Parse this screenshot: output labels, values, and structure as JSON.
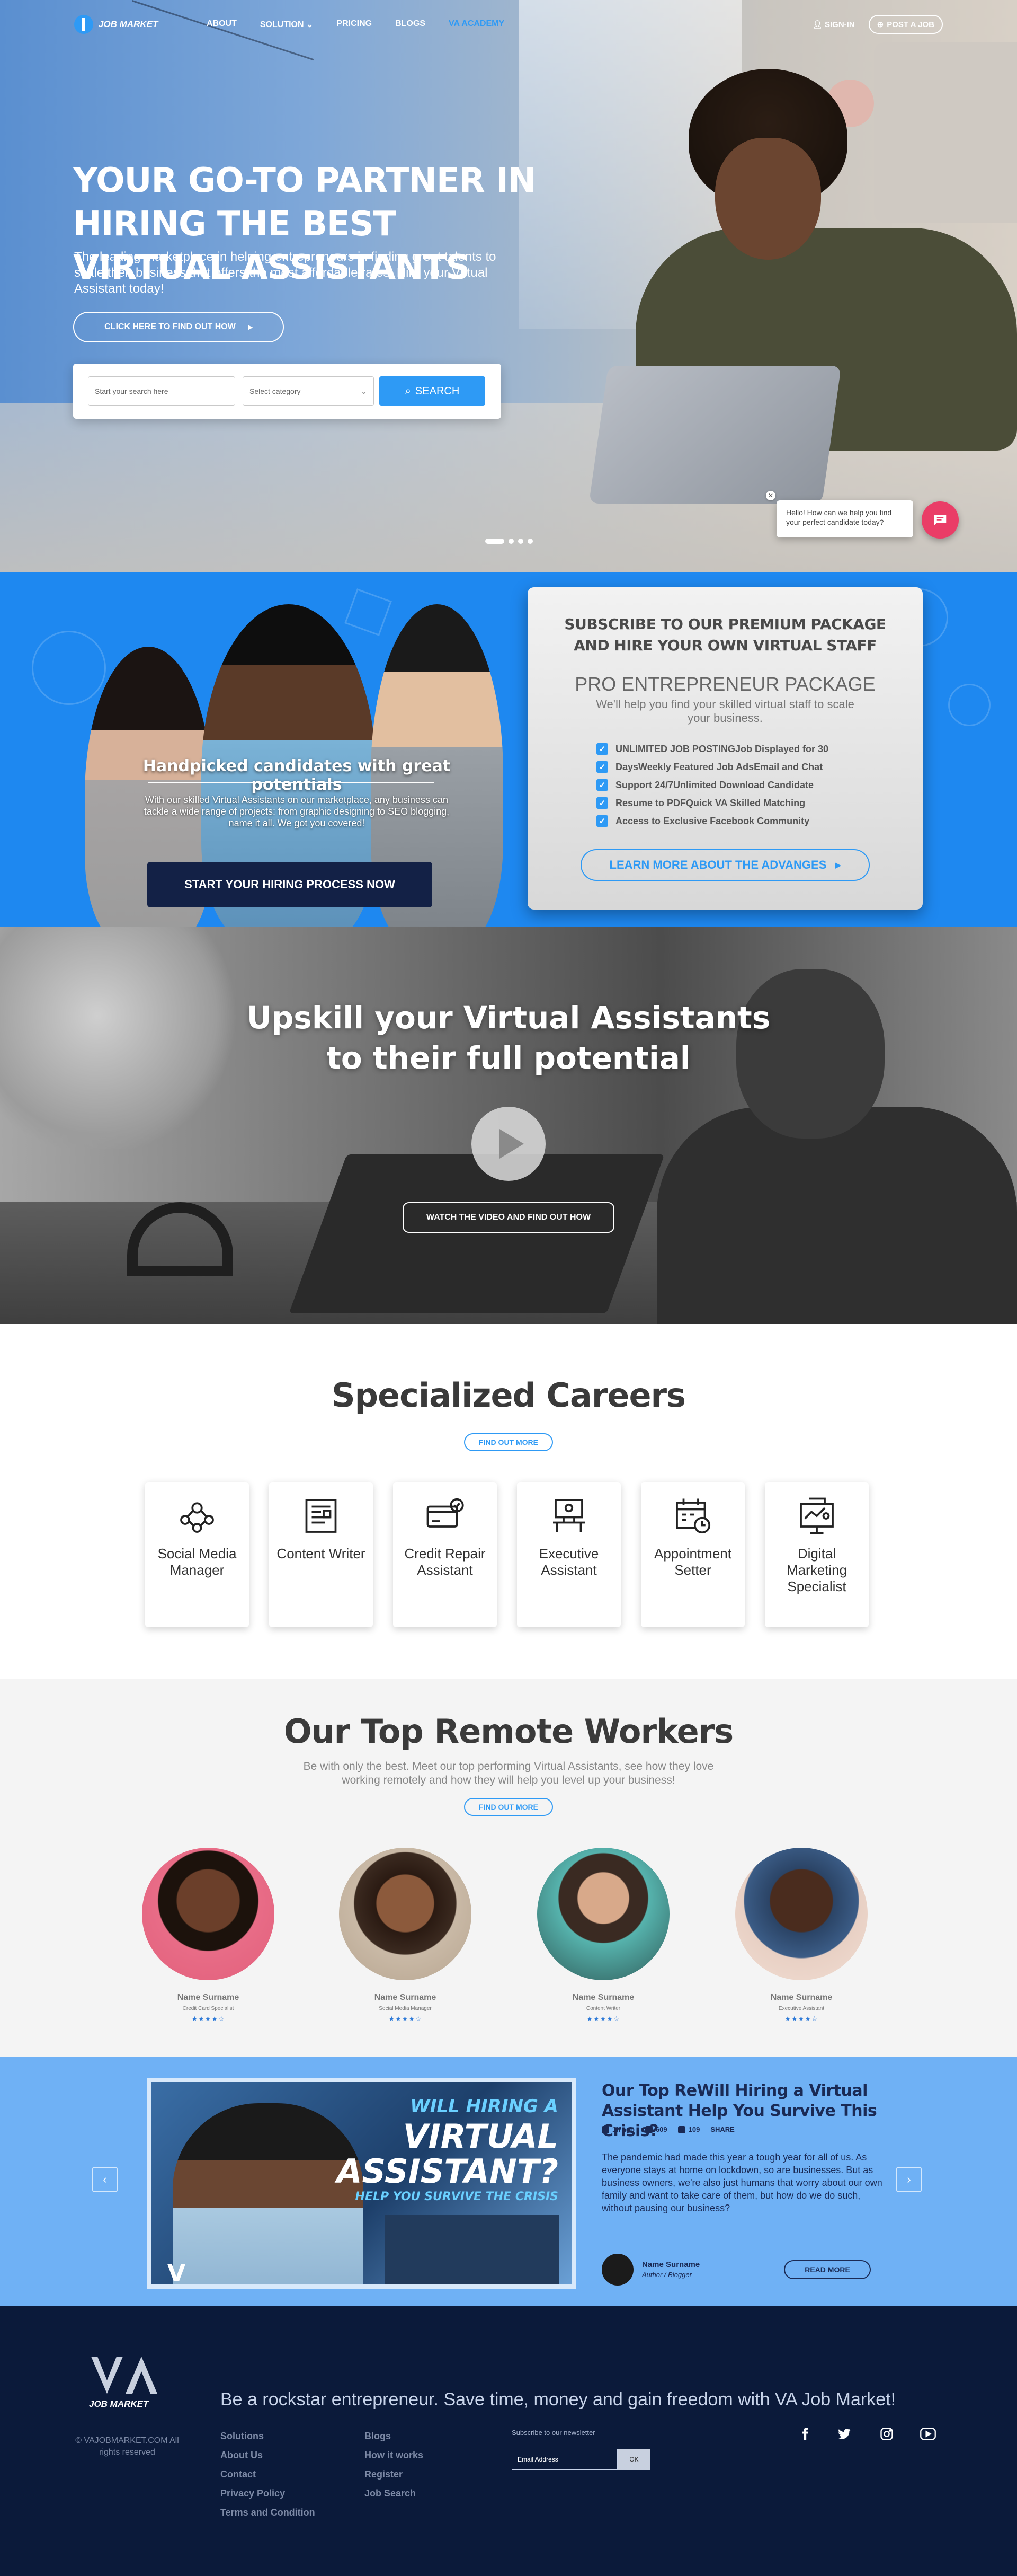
{
  "nav": {
    "logo_text": "JOB MARKET",
    "links": [
      "ABOUT",
      "SOLUTION",
      "PRICING",
      "BLOGS",
      "VA ACADEMY"
    ],
    "sign_in": "SIGN-IN",
    "post_job": "POST A JOB"
  },
  "hero": {
    "title": "YOUR GO-TO PARTNER IN HIRING THE BEST VIRTUAL ASSISTANTS",
    "subtitle": "The leading marketplace in helping entrepreneurs in finding great talents to scale their business that offers the most affordable rates. Hire your Virtual Assistant today!",
    "cta": "CLICK HERE TO FIND OUT HOW",
    "search_placeholder": "Start your search here",
    "category_placeholder": "Select category",
    "search_button": "SEARCH",
    "chat_text": "Hello! How can we help you find your perfect candidate today?"
  },
  "premium": {
    "handpicked_title": "Handpicked candidates with great potentials",
    "handpicked_text": "With our skilled Virtual Assistants on our marketplace, any business can tackle a wide range of projects: from graphic designing to SEO blogging, name it all. We got you covered!",
    "hiring_button": "START YOUR HIRING PROCESS NOW",
    "package_heading": "SUBSCRIBE TO OUR PREMIUM PACKAGE AND HIRE YOUR OWN VIRTUAL STAFF",
    "package_name": "PRO ENTREPRENEUR PACKAGE",
    "package_desc": "We'll help you find your skilled virtual staff to scale your business.",
    "features": [
      "UNLIMITED JOB POSTINGJob Displayed for 30",
      "DaysWeekly Featured Job AdsEmail and Chat",
      "Support 24/7Unlimited Download Candidate",
      "Resume to PDFQuick VA Skilled Matching",
      "Access to Exclusive Facebook Community"
    ],
    "learn_more": "LEARN MORE ABOUT THE ADVANGES"
  },
  "video": {
    "title_line1": "Upskill your Virtual Assistants",
    "title_line2": "to their full potential",
    "button": "WATCH THE VIDEO AND FIND OUT HOW"
  },
  "careers": {
    "title": "Specialized Careers",
    "find_out": "FIND OUT MORE",
    "items": [
      {
        "label": "Social Media Manager",
        "icon": "people-network-icon"
      },
      {
        "label": "Content Writer",
        "icon": "document-icon"
      },
      {
        "label": "Credit Repair Assistant",
        "icon": "credit-card-icon"
      },
      {
        "label": "Executive Assistant",
        "icon": "executive-desk-icon"
      },
      {
        "label": "Appointment Setter",
        "icon": "calendar-clock-icon"
      },
      {
        "label": "Digital Marketing Specialist",
        "icon": "marketing-board-icon"
      }
    ]
  },
  "workers": {
    "title": "Our Top Remote Workers",
    "subtitle": "Be with only the best. Meet our top performing Virtual Assistants, see how they love working remotely and how they will help you level up your business!",
    "find_out": "FIND OUT MORE",
    "items": [
      {
        "name": "Name Surname",
        "role": "Credit Card Specialist",
        "rating": 4.5,
        "stars": "★★★★☆"
      },
      {
        "name": "Name Surname",
        "role": "Social Media Manager",
        "rating": 4.5,
        "stars": "★★★★☆"
      },
      {
        "name": "Name Surname",
        "role": "Content Writer",
        "rating": 4.5,
        "stars": "★★★★☆"
      },
      {
        "name": "Name Surname",
        "role": "Executive Assistant",
        "rating": 4.5,
        "stars": "★★★★☆"
      }
    ]
  },
  "blog": {
    "image_line1": "WILL HIRING A",
    "image_line2": "VIRTUAL",
    "image_line3": "ASSISTANT?",
    "image_line4": "HELP YOU SURVIVE THE CRISIS",
    "title": "Our Top ReWill Hiring a Virtual Assistant Help You Survive This Crisis?",
    "time": "1h ago",
    "views": "609",
    "comments": "109",
    "share": "SHARE",
    "text": "The pandemic had made this year a tough year for all of us. As everyone stays at home on lockdown, so are businesses. But as business owners, we're also just humans that worry about our own family and want to take care of them, but how do we do such, without pausing our business?",
    "author_name": "Name Surname",
    "author_role": "Author / Blogger",
    "read_more": "READ MORE"
  },
  "footer": {
    "logo_text": "JOB MARKET",
    "copyright": "© VAJOBMARKET.COM All rights reserved",
    "tagline": "Be a rockstar entrepreneur. Save time, money and gain freedom with VA Job Market!",
    "col1": [
      "Solutions",
      "About Us",
      "Contact",
      "Privacy Policy",
      "Terms and Condition"
    ],
    "col2": [
      "Blogs",
      "How it works",
      "Register",
      "Job Search"
    ],
    "newsletter_label": "Subscribe to our newsletter",
    "email_placeholder": "Email Address",
    "newsletter_button": "OK"
  },
  "colors": {
    "accent": "#2e9af5",
    "premium_bg": "#1e88f0",
    "blog_bg": "#6fb1f5",
    "footer_bg": "#0b1a3a",
    "chat": "#ea3d67"
  }
}
